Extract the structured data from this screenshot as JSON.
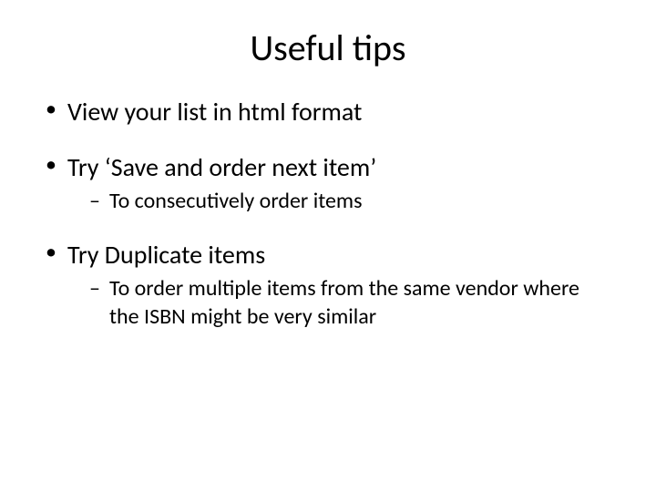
{
  "title": "Useful tips",
  "bullets": [
    {
      "text": "View your list in html format"
    },
    {
      "text": "Try ‘Save and order next item’",
      "sub": [
        {
          "text": "To consecutively order items"
        }
      ]
    },
    {
      "text": "Try Duplicate items",
      "sub": [
        {
          "text": "To order multiple items from the same vendor where the ISBN might be very similar"
        }
      ]
    }
  ]
}
